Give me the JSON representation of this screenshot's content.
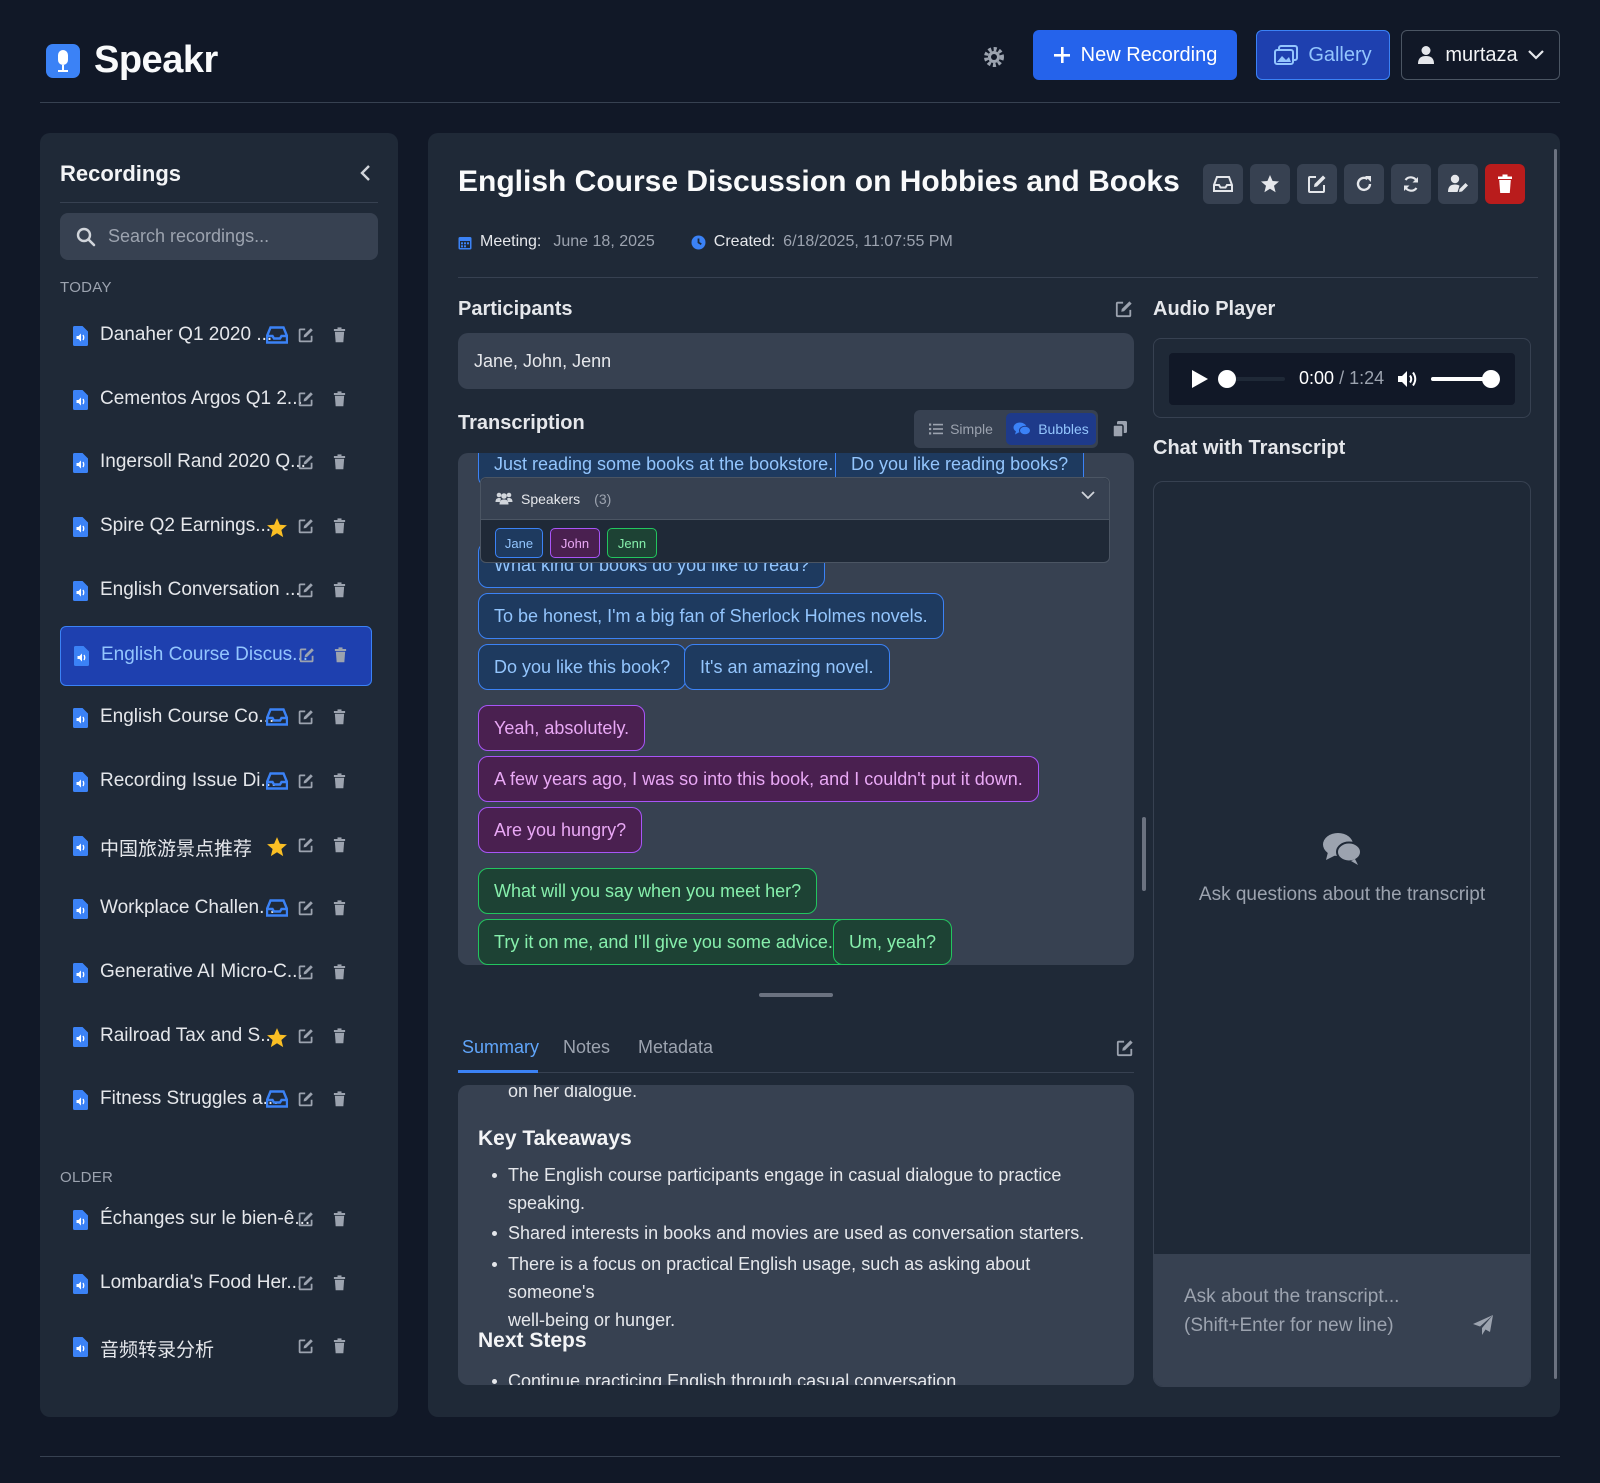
{
  "app": {
    "name": "Speakr"
  },
  "header": {
    "new_recording": "New Recording",
    "gallery": "Gallery",
    "username": "murtaza"
  },
  "sidebar": {
    "title": "Recordings",
    "search_placeholder": "Search recordings...",
    "section_today": "TODAY",
    "section_older": "OLDER",
    "today": [
      {
        "name": "Danaher Q1 2020 ...",
        "badge": "inbox"
      },
      {
        "name": "Cementos Argos Q1 2...",
        "badge": ""
      },
      {
        "name": "Ingersoll Rand 2020 Q...",
        "badge": ""
      },
      {
        "name": "Spire Q2 Earnings...",
        "badge": "star"
      },
      {
        "name": "English Conversation ...",
        "badge": ""
      },
      {
        "name": "English Course Discus...",
        "badge": "",
        "active": true
      },
      {
        "name": "English Course Co...",
        "badge": "inbox"
      },
      {
        "name": "Recording Issue Di...",
        "badge": "inbox"
      },
      {
        "name": "中国旅游景点推荐",
        "badge": "star"
      },
      {
        "name": "Workplace Challen...",
        "badge": "inbox"
      },
      {
        "name": "Generative AI Micro-C...",
        "badge": ""
      },
      {
        "name": "Railroad Tax and S...",
        "badge": "star"
      },
      {
        "name": "Fitness Struggles a...",
        "badge": "inbox"
      }
    ],
    "older": [
      {
        "name": "Échanges sur le bien-ê...",
        "badge": ""
      },
      {
        "name": "Lombardia's Food Her...",
        "badge": ""
      },
      {
        "name": "音频转录分析",
        "badge": ""
      }
    ]
  },
  "recording": {
    "title": "English Course Discussion on Hobbies and Books",
    "meeting_label": "Meeting:",
    "meeting_date": "June 18, 2025",
    "created_label": "Created:",
    "created_value": "6/18/2025, 11:07:55 PM"
  },
  "participants": {
    "title": "Participants",
    "value": "Jane, John, Jenn"
  },
  "transcription": {
    "title": "Transcription",
    "view_simple": "Simple",
    "view_bubbles": "Bubbles",
    "speakers_label": "Speakers",
    "speakers_count": "(3)",
    "speakers": [
      "Jane",
      "John",
      "Jenn"
    ],
    "top_bubbles": [
      "Just reading some books at the bookstore.",
      "Do you like reading books?"
    ],
    "bubbles": [
      {
        "speaker": "Jane",
        "text": "What kind of books do you like to read?"
      },
      {
        "speaker": "Jane",
        "text": "To be honest, I'm a big fan of Sherlock Holmes novels."
      },
      {
        "speaker": "Jane",
        "text": "Do you like this book?"
      },
      {
        "speaker": "Jane",
        "text": "It's an amazing novel."
      },
      {
        "speaker": "John",
        "text": "Yeah, absolutely."
      },
      {
        "speaker": "John",
        "text": "A few years ago, I was so into this book, and I couldn't put it down."
      },
      {
        "speaker": "John",
        "text": "Are you hungry?"
      },
      {
        "speaker": "Jenn",
        "text": "What will you say when you meet her?"
      },
      {
        "speaker": "Jenn",
        "text": "Try it on me, and I'll give you some advice."
      },
      {
        "speaker": "Jenn",
        "text": "Um, yeah?"
      }
    ]
  },
  "tabs": [
    "Summary",
    "Notes",
    "Metadata"
  ],
  "summary": {
    "cut_top": "on her dialogue.",
    "key_takeaways_title": "Key Takeaways",
    "key_takeaways": [
      {
        "line1": "The English course participants engage in casual dialogue to practice",
        "line2": "speaking."
      },
      {
        "line1": "Shared interests in books and movies are used as conversation starters.",
        "line2": ""
      },
      {
        "line1": "There is a focus on practical English usage, such as asking about someone's",
        "line2": "well-being or hunger."
      }
    ],
    "next_steps_title": "Next Steps",
    "next_steps": [
      "Continue practicing English through casual conversation"
    ]
  },
  "audio": {
    "title": "Audio Player",
    "current": "0:00",
    "separator": "/",
    "duration": "1:24",
    "progress": 0.0,
    "volume": 1.0
  },
  "chat": {
    "title": "Chat with Transcript",
    "empty_text": "Ask questions about the transcript",
    "placeholder": "Ask about the transcript...\n(Shift+Enter for new line)"
  },
  "colors": {
    "background": "#111827",
    "panel": "#1f2937",
    "accent": "#2563eb",
    "star": "#fbbf24",
    "danger": "#b91c1c",
    "speaker_jane": "#3b82f6",
    "speaker_john": "#a855f7",
    "speaker_jenn": "#22c55e"
  }
}
